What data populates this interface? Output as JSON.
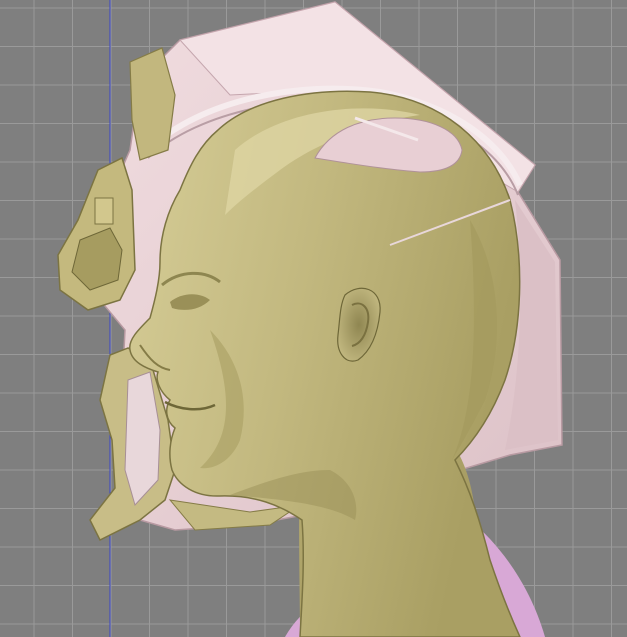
{
  "colors": {
    "background": "#7f7f7f",
    "grid_line": "#9a9a9a",
    "axis_line": "#3a46c8",
    "head_fill": "#c4ba82",
    "head_shadow": "#8e8650",
    "head_highlight": "#e2dcae",
    "helmet_shell": "#ead2d6",
    "helmet_shell_shadow": "#c9adb4",
    "helmet_parts": "#c8bd87",
    "body_accent": "#d8a8d6"
  },
  "icons": {
    "head_model": "head-model-icon",
    "helmet_model": "helmet-model-icon"
  }
}
